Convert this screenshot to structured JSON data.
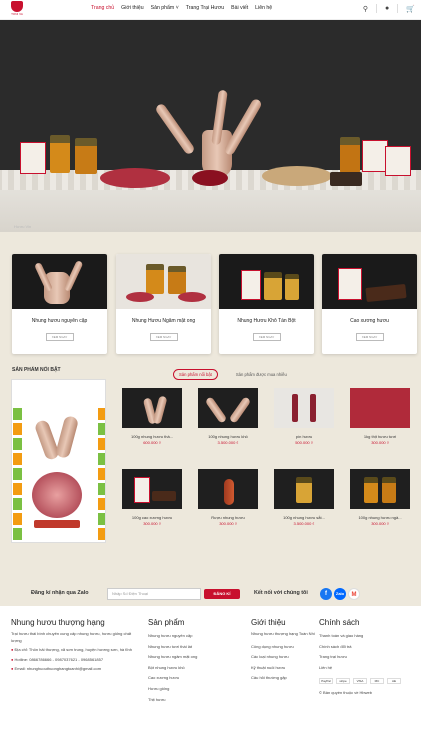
{
  "brand": {
    "logo_text": "TONI VA",
    "color": "#c8102e"
  },
  "nav": [
    "Trang chủ",
    "Giới thiệu",
    "Sản phẩm",
    "Trang Trại Hươu",
    "Bài viết",
    "Liên hệ"
  ],
  "header_icons": [
    "search-icon",
    "user-icon",
    "cart-icon"
  ],
  "hero": {
    "watermark": "Hươu Vin"
  },
  "categories": [
    {
      "name": "Nhung hươu nguyên cặp",
      "button": "XEM NGAY"
    },
    {
      "name": "Nhung Hươu Ngâm mật ong",
      "button": "XEM NGAY"
    },
    {
      "name": "Nhung Hươu Khô Tán Bột",
      "button": "XEM NGAY"
    },
    {
      "name": "Cao xương hươu",
      "button": "XEM NGAY"
    }
  ],
  "featured": {
    "title": "SẢN PHẨM NỔI BẬT",
    "tabs": [
      "Sản phẩm nổi bật",
      "Sản phẩm được mua nhiều"
    ]
  },
  "products": [
    {
      "name": "100g nhung hươu thả...",
      "price": "600.000 ₫"
    },
    {
      "name": "100g nhung hươu khô",
      "price": "3.500.000 ₫"
    },
    {
      "name": "pín hươu",
      "price": "500.000 ₫"
    },
    {
      "name": "1kg thịt hươu tươi",
      "price": "300.000 ₫"
    },
    {
      "name": "100g cao xương hươu",
      "price": "300.000 ₫"
    },
    {
      "name": "Rượu nhung hươu",
      "price": "300.000 ₫"
    },
    {
      "name": "100g nhung hươu sắt...",
      "price": "3.500.000 ₫"
    },
    {
      "name": "100g nhung hươu ngâ...",
      "price": "300.000 ₫"
    }
  ],
  "subscribe": {
    "label": "Đăng kí nhận qua Zalo",
    "placeholder": "Nhập Số Điện Thoại",
    "button": "ĐĂNG KÍ",
    "connect": "Kết nối với chúng tôi"
  },
  "footer": {
    "about": {
      "title": "Nhung hươu thượng hạng",
      "desc": "Trại hươu thái bình chuyên cung cấp nhung hươu, hươu giống chất lượng",
      "address": "Địa chỉ: Thôn hải thượng, xã sơn trung, huyện hương sơn, hà tĩnh",
      "hotline": "Hotline: 0866786666 - 0987037621 - 0968561857",
      "email": "Email: nhunghuouthuonghangtoanhi@gmail.com"
    },
    "products": {
      "title": "Sản phẩm",
      "links": [
        "Nhung hươu nguyên cặp",
        "Nhung hươu tươi thái lát",
        "Nhung hươu ngâm mật ong",
        "Bột nhung hươu khô",
        "Cao xương hươu",
        "Hươu giống",
        "Thịt hươu"
      ]
    },
    "intro": {
      "title": "Giới thiệu",
      "links": [
        "Nhung hươu thượng hạng Toàn Nhi",
        "Công dụng nhung hươu",
        "Các loại nhung hươu",
        "Kỹ thuật nuôi hươu",
        "Câu hỏi thường gặp"
      ]
    },
    "policy": {
      "title": "Chính sách",
      "links": [
        "Thanh toán và giao hàng",
        "Chính sách đổi trả",
        "Trang trại hươu",
        "Liên hệ"
      ],
      "payments": [
        "PayPal",
        "stripe",
        "VISA",
        "MC",
        "AE"
      ],
      "copyright": "© Bản quyền thuộc về Hbweb"
    }
  }
}
